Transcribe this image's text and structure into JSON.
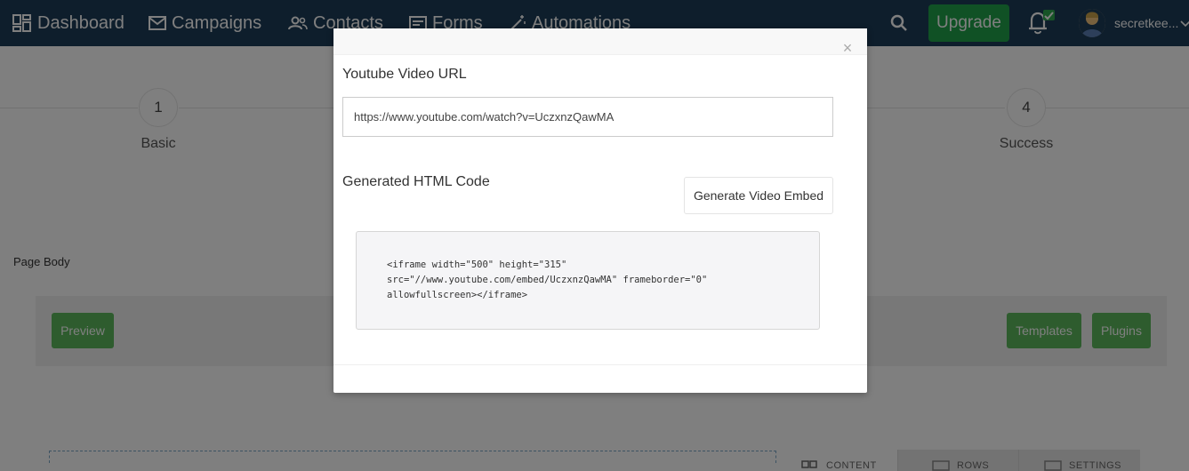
{
  "nav": {
    "items": [
      {
        "label": "Dashboard",
        "icon": "grid-icon"
      },
      {
        "label": "Campaigns",
        "icon": "envelope-icon"
      },
      {
        "label": "Contacts",
        "icon": "users-icon"
      },
      {
        "label": "Forms",
        "icon": "form-icon"
      },
      {
        "label": "Automations",
        "icon": "magic-wand-icon"
      }
    ],
    "upgrade_label": "Upgrade",
    "username": "secretkee..."
  },
  "steps": [
    {
      "number": "1",
      "label": "Basic"
    },
    {
      "number": "4",
      "label": "Success"
    }
  ],
  "page_body_label": "Page Body",
  "toolbar": {
    "preview_label": "Preview",
    "templates_label": "Templates",
    "plugins_label": "Plugins"
  },
  "side_tabs": [
    "CONTENT",
    "ROWS",
    "SETTINGS"
  ],
  "modal": {
    "close_label": "×",
    "url_label": "Youtube Video URL",
    "url_value": "https://www.youtube.com/watch?v=UczxnzQawMA",
    "code_label": "Generated HTML Code",
    "generate_label": "Generate Video Embed",
    "code_lines": [
      "<iframe width=\"500\" height=\"315\"",
      "src=\"//www.youtube.com/embed/UczxnzQawMA\" frameborder=\"0\"",
      "allowfullscreen></iframe>"
    ]
  },
  "colors": {
    "navbar": "#1c3c58",
    "upgrade": "#21a24a",
    "accent_green": "#5cb85c"
  }
}
